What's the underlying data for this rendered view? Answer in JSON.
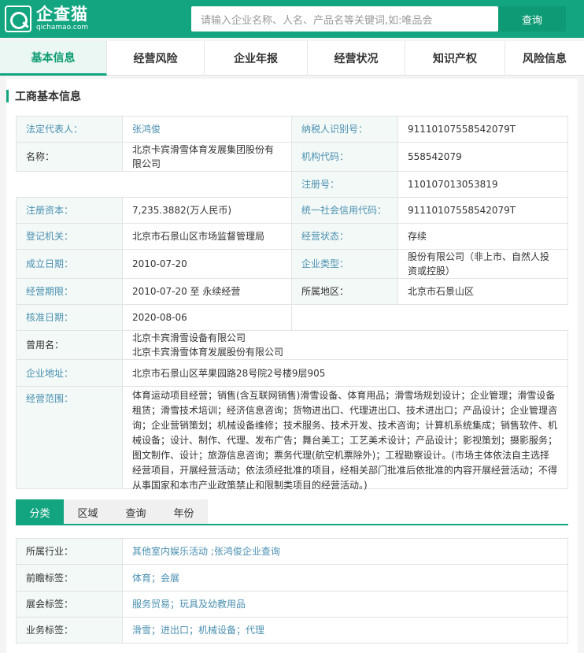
{
  "header": {
    "logo_cn": "企查猫",
    "logo_en": "qichamao.com",
    "search_placeholder": "请输入企业名称、人名、产品名等关键词,如:唯品会",
    "search_button": "查询"
  },
  "nav": [
    "基本信息",
    "经营风险",
    "企业年报",
    "经营状况",
    "知识产权",
    "风险信息"
  ],
  "section_title": "工商基本信息",
  "info": {
    "legal_rep_label": "法定代表人：",
    "legal_rep": "张鸿俊",
    "name_label": "名称：",
    "name": "北京卡宾滑雪体育发展集团股份有限公司",
    "taxpayer_label": "纳税人识别号：",
    "taxpayer": "91110107558542079T",
    "org_code_label": "机构代码：",
    "org_code": "558542079",
    "reg_no_label": "注册号：",
    "reg_no": "110107013053819",
    "capital_label": "注册资本：",
    "capital": "7,235.3882(万人民币)",
    "credit_code_label": "统一社会信用代码：",
    "credit_code": "91110107558542079T",
    "authority_label": "登记机关：",
    "authority": "北京市石景山区市场监督管理局",
    "status_label": "经营状态：",
    "status": "存续",
    "founded_label": "成立日期：",
    "founded": "2010-07-20",
    "type_label": "企业类型：",
    "type": "股份有限公司（非上市、自然人投资或控股）",
    "term_label": "经营期限：",
    "term": "2010-07-20 至 永续经营",
    "region_label": "所属地区：",
    "region": "北京市石景山区",
    "approved_label": "核准日期：",
    "approved": "2020-08-06",
    "former_label": "曾用名：",
    "former_1": "北京卡宾滑雪设备有限公司",
    "former_2": "北京卡宾滑雪体育发展股份有限公司",
    "address_label": "企业地址：",
    "address": "北京市石景山区苹果园路28号院2号楼9层905",
    "scope_label": "经营范围：",
    "scope": "体育运动项目经营；销售(含互联网销售)滑雪设备、体育用品；滑雪场规划设计；企业管理；滑雪设备租赁；滑雪技术培训；经济信息咨询；货物进出口、代理进出口、技术进出口；产品设计；企业管理咨询；企业营销策划；机械设备维修；技术服务、技术开发、技术咨询；计算机系统集成；销售软件、机械设备；设计、制作、代理、发布广告；舞台美工；工艺美术设计；产品设计；影视策划；摄影服务；图文制作、设计；旅游信息咨询；票务代理(航空机票除外)；工程勘察设计。(市场主体依法自主选择经营项目，开展经营活动；依法须经批准的项目，经相关部门批准后依批准的内容开展经营活动；不得从事国家和本市产业政策禁止和限制类项目的经营活动。)"
  },
  "tabs": [
    "分类",
    "区域",
    "查询",
    "年份"
  ],
  "classification": {
    "industry_label": "所属行业：",
    "industry": "其他室内娱乐活动 ;张鸿俊企业查询",
    "forward_label": "前瞻标签：",
    "forward": "体育；会展",
    "expo_label": "展会标签：",
    "expo": "服务贸易；玩具及幼教用品",
    "business_label": "业务标签：",
    "business": "滑雪；进出口；机械设备；代理"
  }
}
